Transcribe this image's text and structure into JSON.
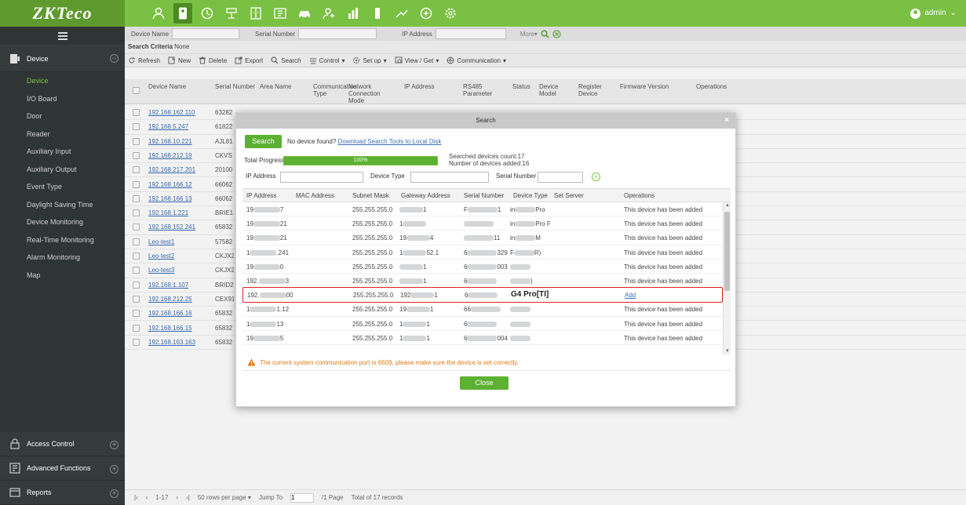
{
  "brand": {
    "logo_text": "ZKTeco"
  },
  "user": {
    "name": "admin"
  },
  "modules": [
    {
      "icon": "person-icon",
      "active": false
    },
    {
      "icon": "id-card-icon",
      "active": true
    },
    {
      "icon": "clock-icon",
      "active": false
    },
    {
      "icon": "meal-icon",
      "active": false
    },
    {
      "icon": "door-panel-icon",
      "active": false
    },
    {
      "icon": "parking-icon",
      "active": false
    },
    {
      "icon": "car-icon",
      "active": false
    },
    {
      "icon": "visitor-icon",
      "active": false
    },
    {
      "icon": "elevator-icon",
      "active": false
    },
    {
      "icon": "guard-icon",
      "active": false
    },
    {
      "icon": "patrol-icon",
      "active": false
    },
    {
      "icon": "shield-plus-icon",
      "active": false
    },
    {
      "icon": "system-gear-icon",
      "active": false
    }
  ],
  "sidebar": {
    "group_label": "Device",
    "items": [
      {
        "label": "Device",
        "active": true
      },
      {
        "label": "I/O Board",
        "active": false
      },
      {
        "label": "Door",
        "active": false
      },
      {
        "label": "Reader",
        "active": false
      },
      {
        "label": "Auxiliary Input",
        "active": false
      },
      {
        "label": "Auxiliary Output",
        "active": false
      },
      {
        "label": "Event Type",
        "active": false
      },
      {
        "label": "Daylight Saving Time",
        "active": false
      },
      {
        "label": "Device Monitoring",
        "active": false
      },
      {
        "label": "Real-Time Monitoring",
        "active": false
      },
      {
        "label": "Alarm Monitoring",
        "active": false
      },
      {
        "label": "Map",
        "active": false
      }
    ],
    "bottom_groups": [
      {
        "label": "Access Control"
      },
      {
        "label": "Advanced Functions"
      },
      {
        "label": "Reports"
      }
    ]
  },
  "search_bar": {
    "device_name_label": "Device Name",
    "serial_number_label": "Serial Number",
    "ip_address_label": "IP Address",
    "more_label": "More▾"
  },
  "criteria": {
    "label": "Search Criteria",
    "value": "None"
  },
  "toolbar": {
    "refresh": "Refresh",
    "new": "New",
    "delete": "Delete",
    "export": "Export",
    "search": "Search",
    "control": "Control",
    "setup": "Set up",
    "view_get": "View / Get",
    "communication": "Communication"
  },
  "table": {
    "headers": {
      "device_name": "Device Name",
      "serial_number": "Serial Number",
      "area_name": "Area Name",
      "communication_type": "Communication Type",
      "network_mode": "Network Connection Mode",
      "ip_address": "IP Address",
      "rs485": "RS485 Parameter",
      "status": "Status",
      "device_model": "Device Model",
      "register_device": "Register Device",
      "firmware": "Firmware Version",
      "operations": "Operations"
    },
    "rows": [
      {
        "name": "192.168.162.110",
        "sn": "63282"
      },
      {
        "name": "192.168.5.247",
        "sn": "61822"
      },
      {
        "name": "192.168.10.221",
        "sn": "AJL81"
      },
      {
        "name": "192.168.212.19",
        "sn": "CKVS"
      },
      {
        "name": "192.168.217.201",
        "sn": "20100"
      },
      {
        "name": "192.168.166.12",
        "sn": "66062"
      },
      {
        "name": "192.168.166.13",
        "sn": "66062"
      },
      {
        "name": "192.168.1.221",
        "sn": "BRIE1"
      },
      {
        "name": "192.168.152.241",
        "sn": "65832"
      },
      {
        "name": "Leo-test1",
        "sn": "57582"
      },
      {
        "name": "Leo-test2",
        "sn": "CKJX2"
      },
      {
        "name": "Leo-test3",
        "sn": "CKJX2"
      },
      {
        "name": "192.168.1.107",
        "sn": "BRID2"
      },
      {
        "name": "192.168.212.25",
        "sn": "CEX91"
      },
      {
        "name": "192.168.166.16",
        "sn": "65832"
      },
      {
        "name": "192.168.166.15",
        "sn": "65832"
      },
      {
        "name": "192.168.163.163",
        "sn": "65832"
      }
    ]
  },
  "pager": {
    "range": "1-17",
    "per_page": "50 rows per page",
    "jump_label": "Jump To",
    "page_value": "1",
    "page_total": "/1 Page",
    "total_records": "Total of 17 records"
  },
  "dialog": {
    "title": "Search",
    "search_button": "Search",
    "no_device_text": "No device found?",
    "download_link": "Download Search Tools to Local Disk",
    "progress_label": "Total Progress",
    "progress_value": 100,
    "progress_text": "100%",
    "searched_count": "Searched devices count:17",
    "added_count": "Number of devices added:16",
    "filter_ip_label": "IP Address",
    "filter_type_label": "Device Type",
    "filter_sn_label": "Serial Number",
    "headers": {
      "ip": "IP Address",
      "mac": "MAC Address",
      "mask": "Subnet Mask",
      "gateway": "Gateway Address",
      "sn": "Serial Number",
      "type": "Device Type",
      "server": "Set Server",
      "ops": "Operations"
    },
    "results": [
      {
        "ip_end": "7",
        "mask": "255.255.255.0",
        "gw_end": "1",
        "sn_start": "F",
        "sn_end": "1",
        "type_start": "in",
        "type_end": "Pro",
        "op": "This device has been added",
        "highlight": false
      },
      {
        "ip_end": "21",
        "mask": "255.255.255.0",
        "gw_end": "",
        "sn_start": "",
        "sn_end": "",
        "type_start": "in",
        "type_end": "Pro F",
        "op": "This device has been added",
        "highlight": false
      },
      {
        "ip_end": "21",
        "mask": "255.255.255.0",
        "gw_end": "4",
        "sn_start": "",
        "sn_end": "11",
        "type_start": "in",
        "type_end": "M",
        "op": "This device has been added",
        "highlight": false
      },
      {
        "ip_end": ".241",
        "mask": "255.255.255.0",
        "gw_end": "52.1",
        "sn_start": "6",
        "sn_end": "329",
        "type_start": "F",
        "type_end": "R)",
        "op": "This device has been added",
        "highlight": false
      },
      {
        "ip_end": "0",
        "mask": "255.255.255.0",
        "gw_end": "1",
        "sn_start": "6",
        "sn_end": "003",
        "type_start": "",
        "type_end": "",
        "op": "This device has been added",
        "highlight": false
      },
      {
        "ip_end": "3",
        "mask": "255.255.255.0",
        "gw_end": "1",
        "sn_start": "6",
        "sn_end": "",
        "type_start": "",
        "type_end": ")",
        "op": "This device has been added",
        "highlight": false
      },
      {
        "ip_end": "00",
        "mask": "255.255.255.0",
        "gw_end": "1",
        "sn_start": "6",
        "sn_end": "",
        "type_start": "G4 Pro[TI]",
        "type_end": "",
        "op": "Add",
        "highlight": true
      },
      {
        "ip_end": "1.12",
        "mask": "255.255.255.0",
        "gw_end": "1",
        "sn_start": "66",
        "sn_end": "",
        "type_start": "",
        "type_end": "",
        "op": "This device has been added",
        "highlight": false
      },
      {
        "ip_end": "13",
        "mask": "255.255.255.0",
        "gw_end": "1",
        "sn_start": "6",
        "sn_end": "",
        "type_start": "",
        "type_end": "",
        "op": "This device has been added",
        "highlight": false
      },
      {
        "ip_end": "5",
        "mask": "255.255.255.0",
        "gw_end": "1",
        "sn_start": "6",
        "sn_end": "004",
        "type_start": "",
        "type_end": "",
        "op": "This device has been added",
        "highlight": false
      }
    ],
    "ip_prefix": [
      "19",
      "19",
      "19",
      "1",
      "19",
      "192.",
      "192.",
      "1",
      "1",
      "19"
    ],
    "gw_prefix": [
      "",
      "1",
      "19",
      "1",
      "",
      "",
      "192",
      "19",
      "1",
      "1"
    ],
    "warning": "The current system communication port is 6609, please make sure the device is set correctly.",
    "close_button": "Close"
  },
  "colors": {
    "brand_green": "#7ac143",
    "button_green": "#5cb032",
    "sidebar_bg": "#2f3434",
    "highlight_red": "#e02020",
    "warning_orange": "#e07a12",
    "link_blue": "#3b6fb6"
  }
}
